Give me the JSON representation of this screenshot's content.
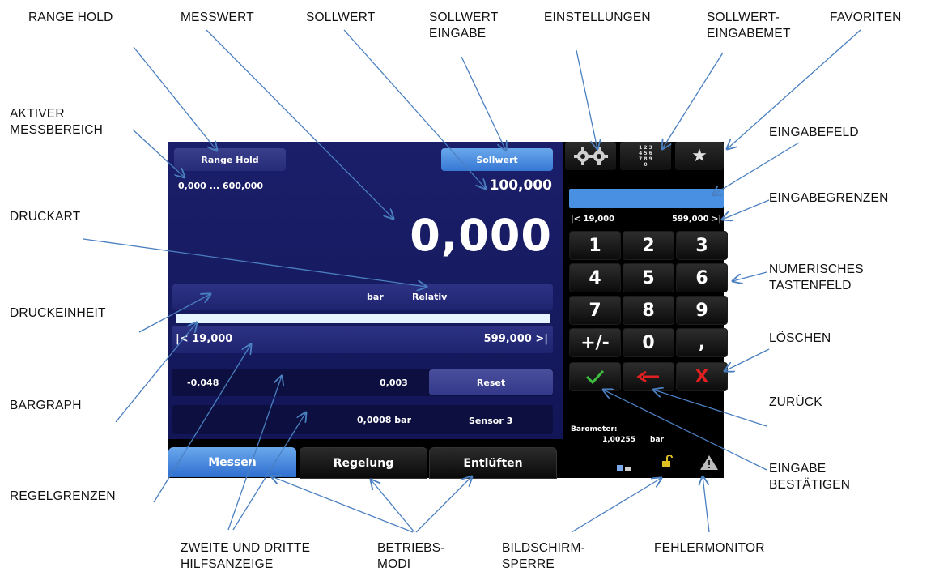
{
  "callouts": {
    "range_hold": "RANGE HOLD",
    "messwert": "MESSWERT",
    "sollwert": "SOLLWERT",
    "sollwert_eingabe": "SOLLWERT\nEINGABE",
    "einstellungen": "EINSTELLUNGEN",
    "sollwert_eingabemethode": "SOLLWERT-\nEINGABEMET",
    "favoriten": "FAVORITEN",
    "aktiver_messbereich": "AKTIVER\nMESSBEREICH",
    "eingabefeld": "EINGABEFELD",
    "druckart": "DRUCKART",
    "eingabegrenzen": "EINGABEGRENZEN",
    "numerisches_tastenfeld": "NUMERISCHES\nTASTENFELD",
    "druckeinheit": "DRUCKEINHEIT",
    "loeschen": "LÖSCHEN",
    "bargraph": "BARGRAPH",
    "zurueck": "ZURÜCK",
    "eingabe_bestaetigen": "EINGABE\nBESTÄTIGEN",
    "regelgrenzen": "REGELGRENZEN",
    "zweite_dritte": "ZWEITE UND DRITTE\nHILFSANZEIGE",
    "betriebsmodi": "BETRIEBS-\nMODI",
    "bildschirmsperre": "BILDSCHIRM-\nSPERRE",
    "fehlermonitor": "FEHLERMONITOR"
  },
  "screen": {
    "range_hold_label": "Range Hold",
    "range_text": "0,000 ... 600,000",
    "sollwert_label": "Sollwert",
    "setpoint_value": "100,000",
    "reading": "0,000",
    "unit": "bar",
    "pressure_type": "Relativ",
    "bar_fill_fraction": 1.0,
    "control_min": "|<  19,000",
    "control_max": "599,000  >|",
    "aux2_left": "-0,048",
    "aux2_right": "0,003",
    "reset_label": "Reset",
    "aux3_value": "0,0008  bar",
    "aux3_sensor": "Sensor 3"
  },
  "keypad": {
    "limit_min": "|< 19,000",
    "limit_max": "599,000 >|",
    "keys": [
      "1",
      "2",
      "3",
      "4",
      "5",
      "6",
      "7",
      "8",
      "9",
      "+/-",
      "0",
      ","
    ],
    "confirm_icon": "check-icon",
    "back_icon": "back-arrow-icon",
    "clear_icon": "clear-x-icon",
    "barometer_label": "Barometer:",
    "barometer_value": "1,00255",
    "barometer_unit": "bar"
  },
  "modes": {
    "messen": "Messen",
    "regelung": "Regelung",
    "entlueften": "Entlüften",
    "active": "Messen"
  },
  "topbar": {
    "settings_icon": "gears-icon",
    "numpad_icon": "numpad-icon",
    "numpad_glyph": "1 2 3\n4 5 6\n7 8 9\n0",
    "favorites_icon": "star-icon"
  },
  "colors": {
    "panel": "#1b1f6a",
    "accent_blue": "#3677d4",
    "confirm_green": "#3fbf3f",
    "back_red": "#e02020",
    "clear_red": "#e02020",
    "lock_yellow": "#e0c020"
  }
}
